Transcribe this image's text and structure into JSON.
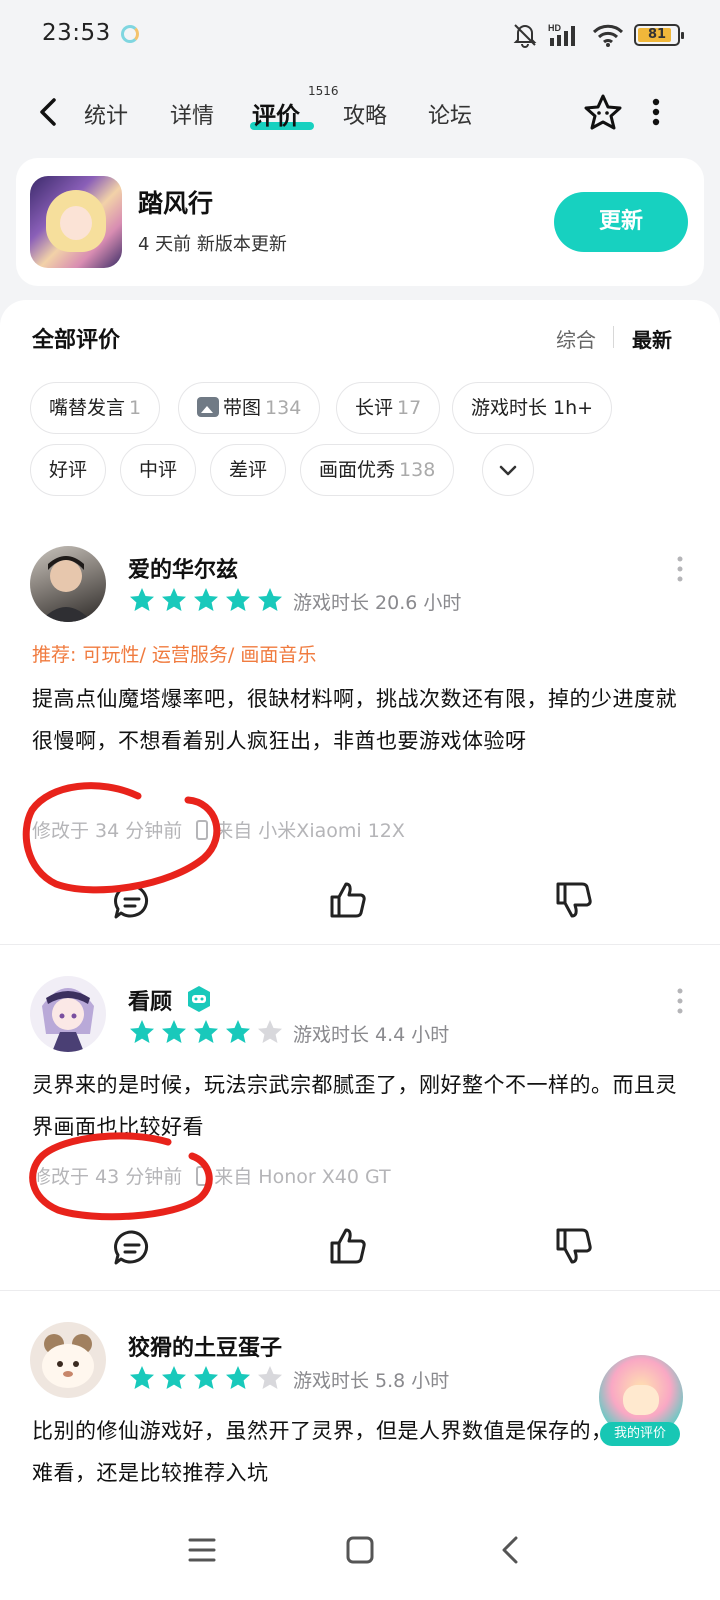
{
  "status_bar": {
    "time": "23:53",
    "battery": "81",
    "network": "HD"
  },
  "top_nav": {
    "tabs": [
      "统计",
      "详情",
      "评价",
      "攻略",
      "论坛"
    ],
    "active_tab": "评价",
    "review_count_badge": "1516"
  },
  "app": {
    "name": "踏风行",
    "subtitle": "4 天前 新版本更新",
    "update_label": "更新"
  },
  "reviews_header": {
    "title": "全部评价",
    "sort_options": [
      "综合",
      "最新"
    ],
    "active_sort": "最新"
  },
  "filter_chips": [
    {
      "label": "嘴替发言",
      "count": "1"
    },
    {
      "label": "带图",
      "count": "134"
    },
    {
      "label": "长评",
      "count": "17"
    },
    {
      "label": "游戏时长 1h+",
      "count": ""
    },
    {
      "label": "好评",
      "count": ""
    },
    {
      "label": "中评",
      "count": ""
    },
    {
      "label": "差评",
      "count": ""
    },
    {
      "label": "画面优秀",
      "count": "138"
    }
  ],
  "reviews": [
    {
      "author": "爱的华尔兹",
      "rating": 5,
      "play_time": "游戏时长 20.6 小时",
      "recommend": "推荐: 可玩性/ 运营服务/ 画面音乐",
      "text": "提高点仙魔塔爆率吧，很缺材料啊，挑战次数还有限，掉的少进度就很慢啊，不想看着别人疯狂出，非酋也要游戏体验呀",
      "modified": "修改于 34 分钟前",
      "device": "来自 小米Xiaomi 12X"
    },
    {
      "author": "看顾",
      "rating": 4,
      "play_time": "游戏时长 4.4 小时",
      "text": "灵界来的是时候，玩法宗武宗都腻歪了，刚好整个不一样的。而且灵界画面也比较好看",
      "modified": "修改于 43 分钟前",
      "device": "来自 Honor X40 GT"
    },
    {
      "author": "狡猾的土豆蛋子",
      "rating": 4,
      "play_time": "游戏时长 5.8 小时",
      "text": "比别的修仙游戏好，虽然开了灵界，但是人界数值是保存的，吃相不难看，还是比较推荐入坑"
    }
  ],
  "fab": {
    "label": "我的评价"
  },
  "colors": {
    "accent": "#17d1c0",
    "star_on": "#19c9bb",
    "star_off": "#d8d8dc",
    "recommend": "#f07b3f",
    "scribble": "#e8231b"
  },
  "icons": [
    "back-icon",
    "favorite-star-icon",
    "more-vertical-icon",
    "comment-icon",
    "thumb-up-icon",
    "thumb-down-icon",
    "menu-icon",
    "home-icon",
    "back-nav-icon"
  ]
}
